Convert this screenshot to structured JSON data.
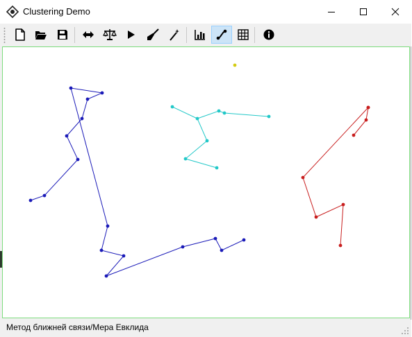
{
  "window": {
    "title": "Clustering Demo",
    "controls": [
      "minimize",
      "maximize",
      "close"
    ]
  },
  "toolbar": {
    "buttons": [
      {
        "name": "new-file",
        "icon": "new-file-icon"
      },
      {
        "name": "open",
        "icon": "folder-open-icon"
      },
      {
        "name": "save",
        "icon": "floppy-disk-icon"
      },
      {
        "name": "resize",
        "icon": "double-arrow-icon"
      },
      {
        "name": "balance",
        "icon": "scales-icon"
      },
      {
        "name": "run",
        "icon": "play-icon"
      },
      {
        "name": "clear",
        "icon": "broom-icon"
      },
      {
        "name": "generate",
        "icon": "magic-wand-icon"
      },
      {
        "name": "chart",
        "icon": "bar-chart-icon"
      },
      {
        "name": "graph",
        "icon": "graph-link-icon",
        "active": true
      },
      {
        "name": "grid",
        "icon": "grid-icon"
      },
      {
        "name": "info",
        "icon": "info-icon"
      }
    ],
    "active_color": "#cce4f7"
  },
  "canvas": {
    "border_color": "#7cdc7c",
    "clusters": [
      {
        "color": "#1a1ab8",
        "points": [
          [
            40,
            221
          ],
          [
            60,
            214
          ],
          [
            108,
            162
          ],
          [
            92,
            128
          ],
          [
            114,
            103
          ],
          [
            122,
            75
          ],
          [
            143,
            66
          ],
          [
            98,
            59
          ],
          [
            151,
            258
          ],
          [
            142,
            293
          ],
          [
            174,
            301
          ],
          [
            149,
            330
          ],
          [
            259,
            288
          ],
          [
            306,
            276
          ],
          [
            315,
            293
          ],
          [
            347,
            278
          ]
        ]
      },
      {
        "color": "#22c8c8",
        "points": [
          [
            244,
            86
          ],
          [
            280,
            103
          ],
          [
            294,
            135
          ],
          [
            263,
            161
          ],
          [
            308,
            174
          ]
        ],
        "extra_points": [
          [
            311,
            92
          ],
          [
            319,
            95
          ],
          [
            383,
            100
          ]
        ]
      },
      {
        "color": "#c81e1e",
        "points": [
          [
            526,
            87
          ],
          [
            523,
            105
          ],
          [
            505,
            127
          ]
        ],
        "chain2": [
          [
            526,
            87
          ],
          [
            432,
            188
          ],
          [
            451,
            245
          ],
          [
            490,
            227
          ],
          [
            486,
            286
          ]
        ]
      },
      {
        "color": "#d4cc14",
        "points": [
          [
            334,
            26
          ]
        ]
      }
    ]
  },
  "status": {
    "text": "Метод ближней связи/Мера Евклида"
  }
}
